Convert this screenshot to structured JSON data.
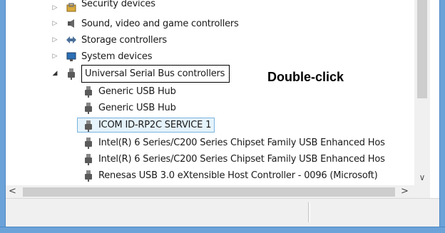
{
  "tree": {
    "items": [
      {
        "label": "Security devices",
        "icon": "security-devices-icon",
        "expanded": false
      },
      {
        "label": "Sound, video and game controllers",
        "icon": "speaker-icon",
        "expanded": false
      },
      {
        "label": "Storage controllers",
        "icon": "storage-icon",
        "expanded": false
      },
      {
        "label": "System devices",
        "icon": "system-devices-icon",
        "expanded": false
      },
      {
        "label": "Universal Serial Bus controllers",
        "icon": "usb-icon",
        "expanded": true
      }
    ],
    "children": [
      {
        "label": "Generic USB Hub",
        "icon": "usb-icon"
      },
      {
        "label": "Generic USB Hub",
        "icon": "usb-icon"
      },
      {
        "label": "ICOM ID-RP2C SERVICE 1",
        "icon": "usb-icon",
        "selected": true
      },
      {
        "label": "Intel(R) 6 Series/C200 Series Chipset Family USB Enhanced Hos",
        "icon": "usb-icon"
      },
      {
        "label": "Intel(R) 6 Series/C200 Series Chipset Family USB Enhanced Hos",
        "icon": "usb-icon"
      },
      {
        "label": "Renesas USB 3.0 eXtensible Host Controller - 0096 (Microsoft)",
        "icon": "usb-icon"
      }
    ]
  },
  "callout": "Double-click",
  "scroll": {
    "left_arrow": "<",
    "right_arrow": ">",
    "down_arrow": "∨"
  },
  "colors": {
    "frame": "#6ba2d8",
    "selection_bg": "#e5f3fb",
    "selection_border": "#7ab4e0"
  }
}
